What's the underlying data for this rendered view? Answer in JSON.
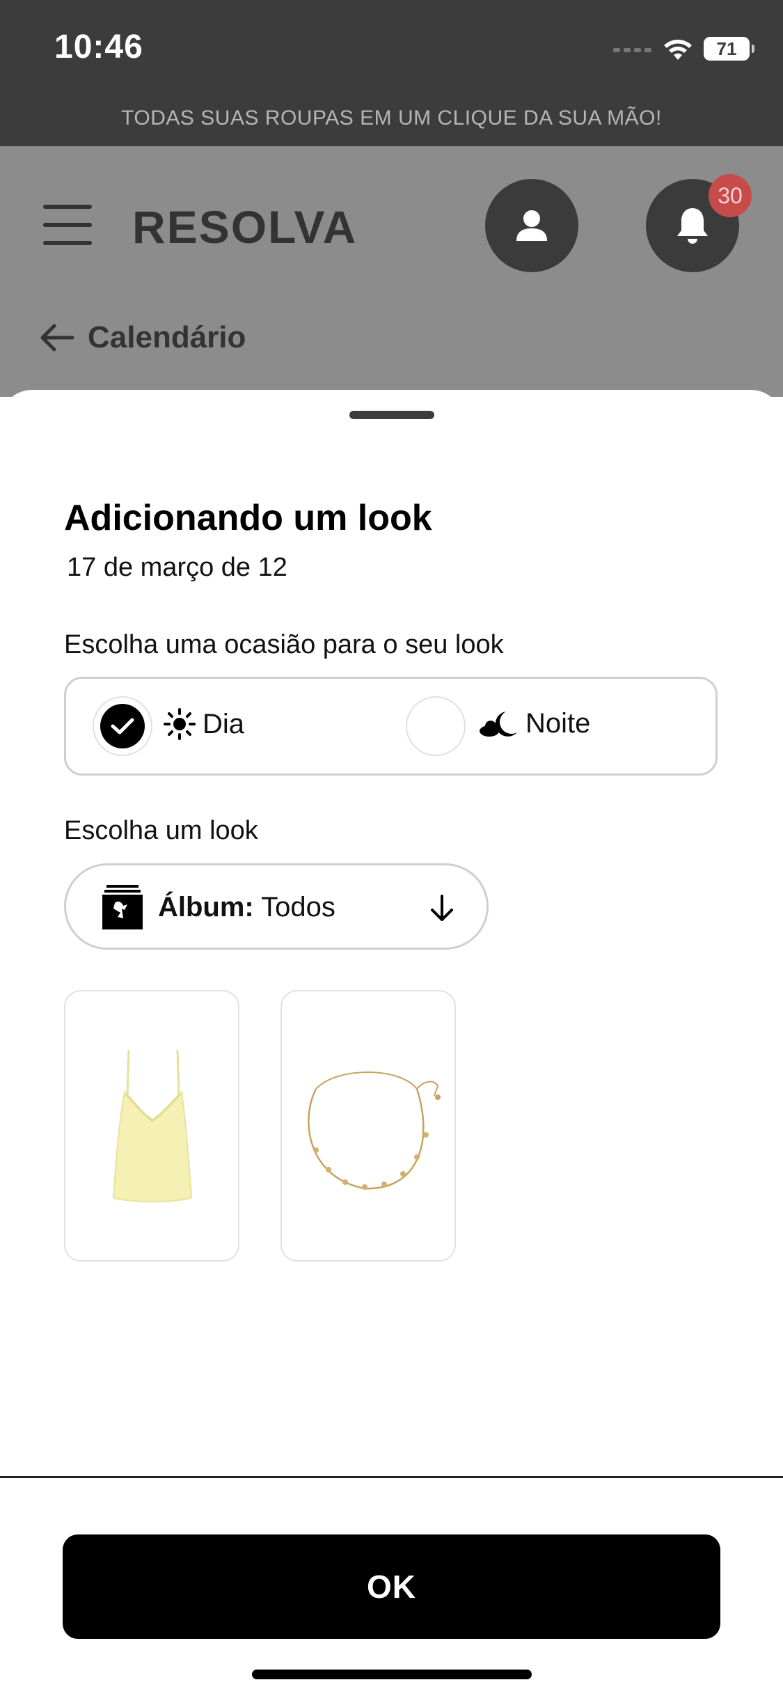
{
  "status_bar": {
    "time": "10:46",
    "battery": "71"
  },
  "promo": {
    "text": "TODAS SUAS ROUPAS EM UM CLIQUE DA SUA MÃO!"
  },
  "header": {
    "brand": "RESOLVA",
    "notifications_count": "30",
    "back_label": "Calendário",
    "icons": [
      "menu-icon",
      "user-icon",
      "bell-icon",
      "arrow-left-icon"
    ]
  },
  "sheet": {
    "title": "Adicionando um look",
    "date": "17 de março de 12",
    "occasion_label": "Escolha uma ocasião para o seu look",
    "occasions": [
      {
        "label": "Dia",
        "icon": "sun-icon",
        "selected": true
      },
      {
        "label": "Noite",
        "icon": "moon-cloud-icon",
        "selected": false
      }
    ],
    "look_label": "Escolha um look",
    "album": {
      "prefix": "Álbum:",
      "value": "Todos"
    },
    "items": [
      {
        "name": "yellow camisole top",
        "icon": "camisole-image"
      },
      {
        "name": "gold charm necklace",
        "icon": "necklace-image"
      }
    ],
    "ok_label": "OK"
  },
  "colors": {
    "dark": "#3c3c3c",
    "header_overlay": "#8c8c8c",
    "badge": "#c84b4b",
    "primary": "#000000"
  }
}
